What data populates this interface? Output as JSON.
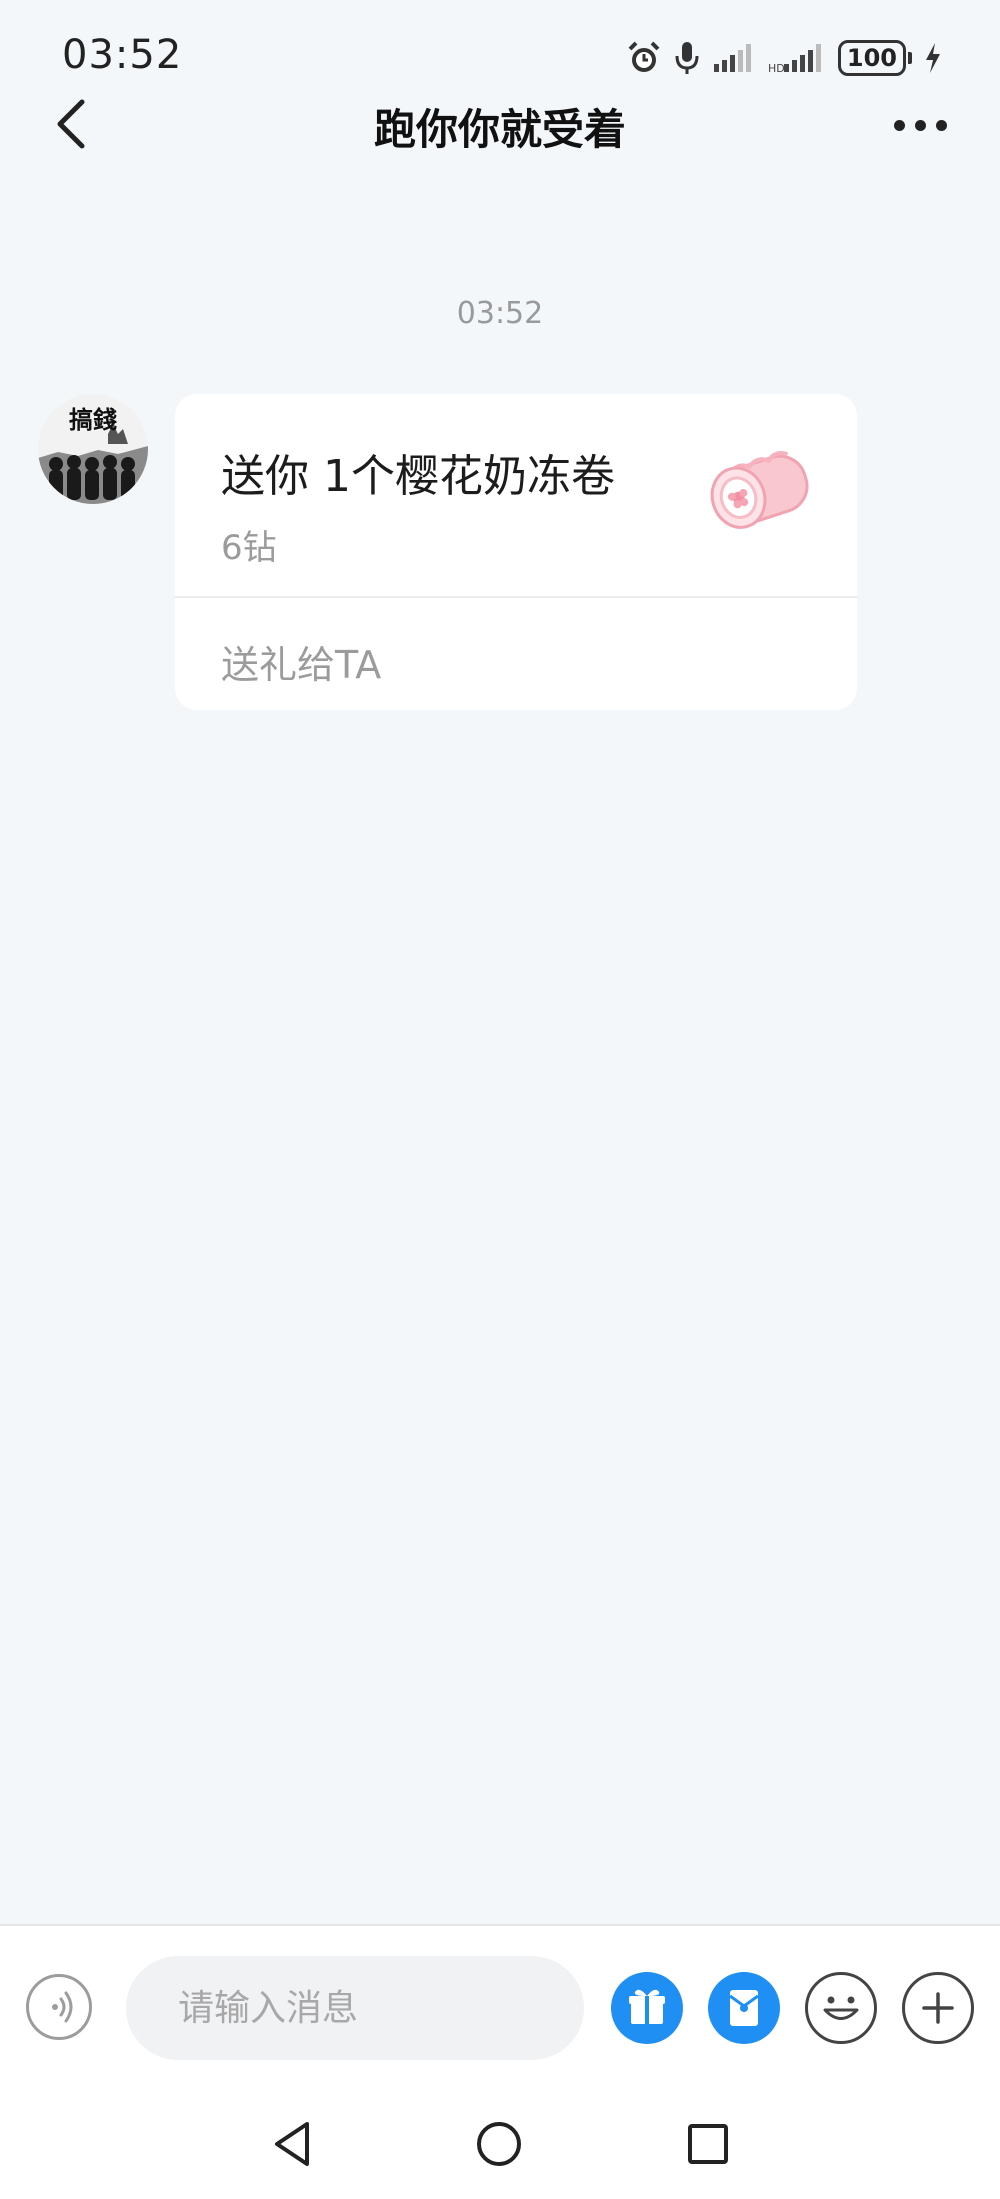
{
  "status_bar": {
    "time": "03:52",
    "battery": "100",
    "icons": [
      "alarm-icon",
      "mic-icon",
      "signal-icon",
      "signal-icon",
      "battery-icon",
      "charging-icon"
    ]
  },
  "header": {
    "title": "跑你你就受着",
    "back_icon": "chevron-left-icon",
    "more_icon": "more-horizontal-icon"
  },
  "chat": {
    "timestamp": "03:52",
    "avatar_text": "搞錢",
    "gift_message": {
      "title": "送你 1个樱花奶冻卷",
      "price": "6钻",
      "action": "送礼给TA",
      "image_icon": "cherry-blossom-roll-cake-icon"
    }
  },
  "input_bar": {
    "placeholder": "请输入消息",
    "buttons": [
      "voice-icon",
      "gift-icon",
      "red-packet-icon",
      "emoji-icon",
      "plus-icon"
    ]
  },
  "colors": {
    "background": "#f4f7fa",
    "accent": "#1f8ff3",
    "card": "#ffffff",
    "muted_text": "#9b9b9b"
  }
}
